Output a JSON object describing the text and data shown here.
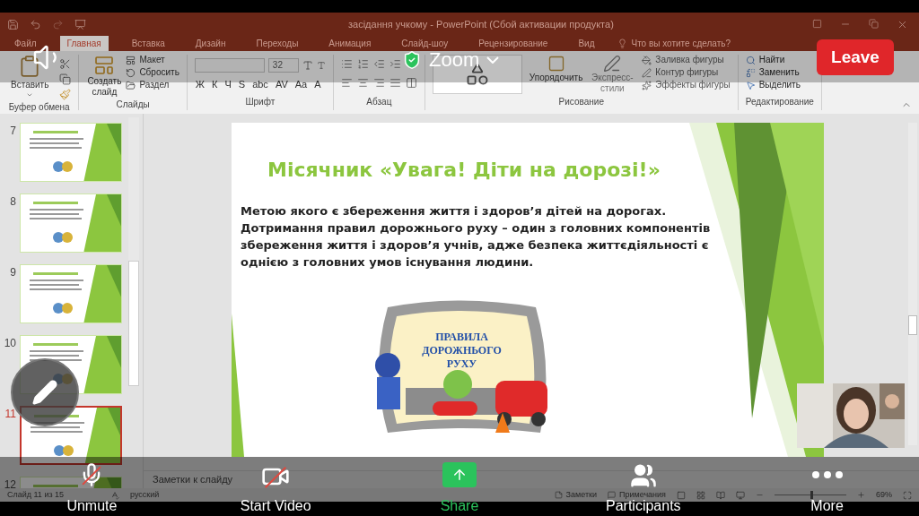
{
  "powerpoint": {
    "title": "засідання учкому - PowerPoint (Сбой активации продукта)",
    "tabs": [
      {
        "label": "Файл",
        "selected": false
      },
      {
        "label": "Главная",
        "selected": true
      },
      {
        "label": "Вставка",
        "selected": false
      },
      {
        "label": "Дизайн",
        "selected": false
      },
      {
        "label": "Переходы",
        "selected": false
      },
      {
        "label": "Анимация",
        "selected": false
      },
      {
        "label": "Слайд-шоу",
        "selected": false
      },
      {
        "label": "Рецензирование",
        "selected": false
      },
      {
        "label": "Вид",
        "selected": false
      }
    ],
    "tell_me": "Что вы хотите сделать?",
    "ribbon": [
      {
        "kind": "clipboard",
        "label": "Буфер обмена",
        "paste": "Вставить"
      },
      {
        "kind": "slides",
        "label": "Слайды",
        "new_slide": "Создать слайд",
        "items": [
          "Макет",
          "Сбросить",
          "Раздел"
        ]
      },
      {
        "kind": "font",
        "label": "Шрифт",
        "font_size": "32",
        "buttons": [
          "Ж",
          "К",
          "Ч",
          "S",
          "abc",
          "AV",
          "Aa",
          "A"
        ]
      },
      {
        "kind": "paragraph",
        "label": "Абзац"
      },
      {
        "kind": "drawing",
        "label": "Рисование",
        "arrange": "Упорядочить",
        "styles": "Экспресс-стили",
        "items": [
          "Заливка фигуры",
          "Контур фигуры",
          "Эффекты фигуры"
        ]
      },
      {
        "kind": "editing",
        "label": "Редактирование",
        "items": [
          "Найти",
          "Заменить",
          "Выделить"
        ]
      }
    ],
    "thumbnails": [
      {
        "number": "7",
        "selected": false
      },
      {
        "number": "8",
        "selected": false
      },
      {
        "number": "9",
        "selected": false
      },
      {
        "number": "10",
        "selected": false
      },
      {
        "number": "11",
        "selected": true
      },
      {
        "number": "12",
        "selected": false
      }
    ],
    "slide": {
      "title": "Місячник «Увага! Діти на дорозі!»",
      "body": "Метою якого є збереження життя і здоров’я дітей на дорогах. Дотримання правил дорожнього руху – один з головних компонентів збереження життя і здоров’я учнів, адже безпека життєдіяльності є однією з головних умов існування людини.",
      "illustration_caption": [
        "ПРАВИЛА",
        "ДОРОЖНЬОГО",
        "РУХУ"
      ]
    },
    "notes_placeholder": "Заметки к слайду",
    "status_bar": {
      "slide": "Слайд 11 из 15",
      "language": "русский",
      "notes": "Заметки",
      "comments": "Примечания",
      "zoom": "69%",
      "zoom_slider": {
        "level": 0.5
      }
    }
  },
  "zoom": {
    "title": "Zoom",
    "leave": "Leave",
    "toolbar": [
      {
        "kind": "mic",
        "label": "Unmute",
        "off": true
      },
      {
        "kind": "video",
        "label": "Start Video",
        "off": true
      },
      {
        "kind": "share",
        "label": "Share",
        "off": false
      },
      {
        "kind": "participants",
        "label": "Participants",
        "off": false
      },
      {
        "kind": "more",
        "label": "More",
        "off": false
      }
    ]
  }
}
